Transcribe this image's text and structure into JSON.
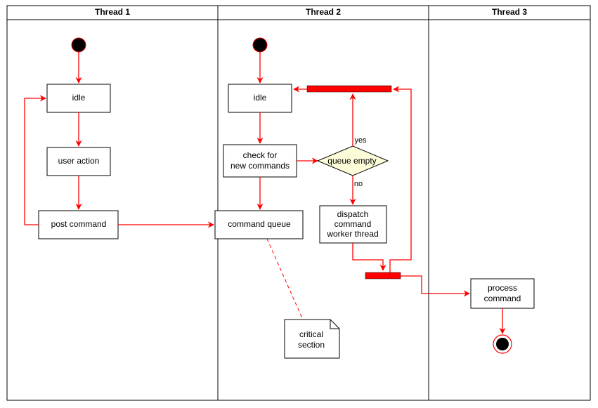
{
  "chart_data": {
    "type": "activity-diagram",
    "swimlanes": [
      "Thread 1",
      "Thread 2",
      "Thread 3"
    ],
    "nodes": [
      {
        "id": "t1_start",
        "lane": 0,
        "kind": "initial"
      },
      {
        "id": "t1_idle",
        "lane": 0,
        "kind": "activity",
        "label": "idle"
      },
      {
        "id": "t1_user_action",
        "lane": 0,
        "kind": "activity",
        "label": "user action"
      },
      {
        "id": "t1_post_command",
        "lane": 0,
        "kind": "activity",
        "label": "post command"
      },
      {
        "id": "t2_start",
        "lane": 1,
        "kind": "initial"
      },
      {
        "id": "t2_idle",
        "lane": 1,
        "kind": "activity",
        "label": "idle"
      },
      {
        "id": "t2_check",
        "lane": 1,
        "kind": "activity",
        "label": "check for\nnew commands"
      },
      {
        "id": "t2_queue",
        "lane": 1,
        "kind": "activity",
        "label": "command queue"
      },
      {
        "id": "t2_decision",
        "lane": 1,
        "kind": "decision",
        "label": "queue empty"
      },
      {
        "id": "t2_dispatch",
        "lane": 1,
        "kind": "activity",
        "label": "dispatch\ncommand\nworker thread"
      },
      {
        "id": "t2_bar_top",
        "lane": 1,
        "kind": "sync-bar"
      },
      {
        "id": "t2_bar_bottom",
        "lane": 1,
        "kind": "sync-bar"
      },
      {
        "id": "t2_note",
        "lane": 1,
        "kind": "note",
        "label": "critical\nsection"
      },
      {
        "id": "t3_process",
        "lane": 2,
        "kind": "activity",
        "label": "process\ncommand"
      },
      {
        "id": "t3_end",
        "lane": 2,
        "kind": "final"
      }
    ],
    "edges": [
      {
        "from": "t1_start",
        "to": "t1_idle"
      },
      {
        "from": "t1_idle",
        "to": "t1_user_action"
      },
      {
        "from": "t1_user_action",
        "to": "t1_post_command"
      },
      {
        "from": "t1_post_command",
        "to": "t1_idle",
        "routing": "loop-back-left"
      },
      {
        "from": "t1_post_command",
        "to": "t2_queue"
      },
      {
        "from": "t2_start",
        "to": "t2_idle"
      },
      {
        "from": "t2_idle",
        "to": "t2_check"
      },
      {
        "from": "t2_check",
        "to": "t2_queue"
      },
      {
        "from": "t2_check",
        "to": "t2_decision"
      },
      {
        "from": "t2_decision",
        "to": "t2_bar_top",
        "label": "yes"
      },
      {
        "from": "t2_decision",
        "to": "t2_dispatch",
        "label": "no"
      },
      {
        "from": "t2_dispatch",
        "to": "t2_bar_bottom"
      },
      {
        "from": "t2_bar_top",
        "to": "t2_idle"
      },
      {
        "from": "t2_bar_bottom",
        "to": "t2_bar_top",
        "routing": "loop-back-right"
      },
      {
        "from": "t2_bar_bottom",
        "to": "t3_process"
      },
      {
        "from": "t3_process",
        "to": "t3_end"
      },
      {
        "from": "t2_queue",
        "to": "t2_note",
        "style": "dashed"
      }
    ]
  },
  "lanes": {
    "t1": "Thread 1",
    "t2": "Thread 2",
    "t3": "Thread 3"
  },
  "labels": {
    "t1_idle": "idle",
    "t1_user_action": "user action",
    "t1_post_command": "post command",
    "t2_idle": "idle",
    "t2_check_l1": "check for",
    "t2_check_l2": "new commands",
    "t2_queue": "command queue",
    "t2_decision": "queue empty",
    "t2_dispatch_l1": "dispatch",
    "t2_dispatch_l2": "command",
    "t2_dispatch_l3": "worker thread",
    "t2_note_l1": "critical",
    "t2_note_l2": "section",
    "t3_process_l1": "process",
    "t3_process_l2": "command",
    "edge_yes": "yes",
    "edge_no": "no"
  },
  "colors": {
    "stroke": "#000000",
    "flow": "#ff0000",
    "bar": "#ff0000",
    "diamond_fill": "#fffde7",
    "box_fill": "#ffffff"
  }
}
